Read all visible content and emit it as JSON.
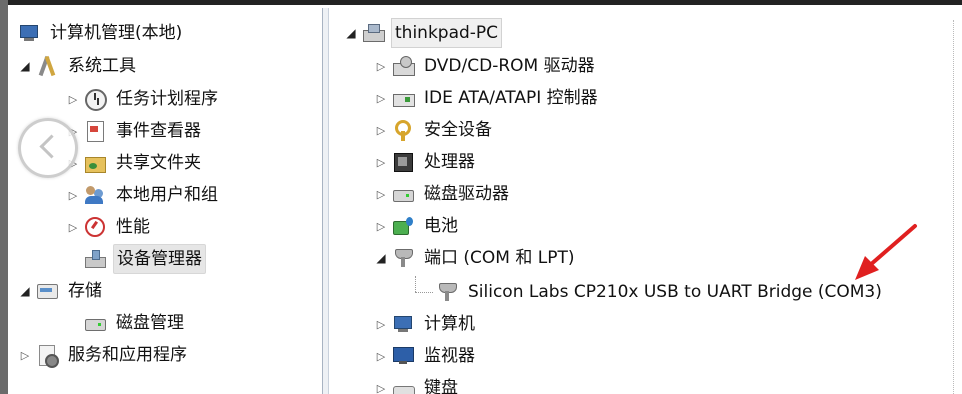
{
  "left_tree": {
    "root_label": "计算机管理(本地)",
    "system_tools": {
      "label": "系统工具",
      "children": [
        "任务计划程序",
        "事件查看器",
        "共享文件夹",
        "本地用户和组",
        "性能",
        "设备管理器"
      ]
    },
    "storage": {
      "label": "存储",
      "children": [
        "磁盘管理"
      ]
    },
    "services_label": "服务和应用程序"
  },
  "device_tree": {
    "root_label": "thinkpad-PC",
    "categories": [
      "DVD/CD-ROM 驱动器",
      "IDE ATA/ATAPI 控制器",
      "安全设备",
      "处理器",
      "磁盘驱动器",
      "电池",
      "端口 (COM 和 LPT)",
      "计算机",
      "监视器",
      "键盘"
    ],
    "com_port_device": "Silicon Labs CP210x USB to UART Bridge (COM3)"
  },
  "icons": {
    "computer": "computer-management-icon",
    "tools": "tools-icon",
    "clock": "task-scheduler-icon",
    "log": "event-viewer-icon",
    "share": "shared-folder-icon",
    "users": "users-icon",
    "perf": "performance-icon",
    "device": "device-manager-icon",
    "storage": "storage-icon",
    "disk": "disk-icon",
    "services": "services-icon"
  },
  "colors": {
    "annotation_arrow": "#e02020",
    "selection_bg": "#e6e6e6"
  }
}
